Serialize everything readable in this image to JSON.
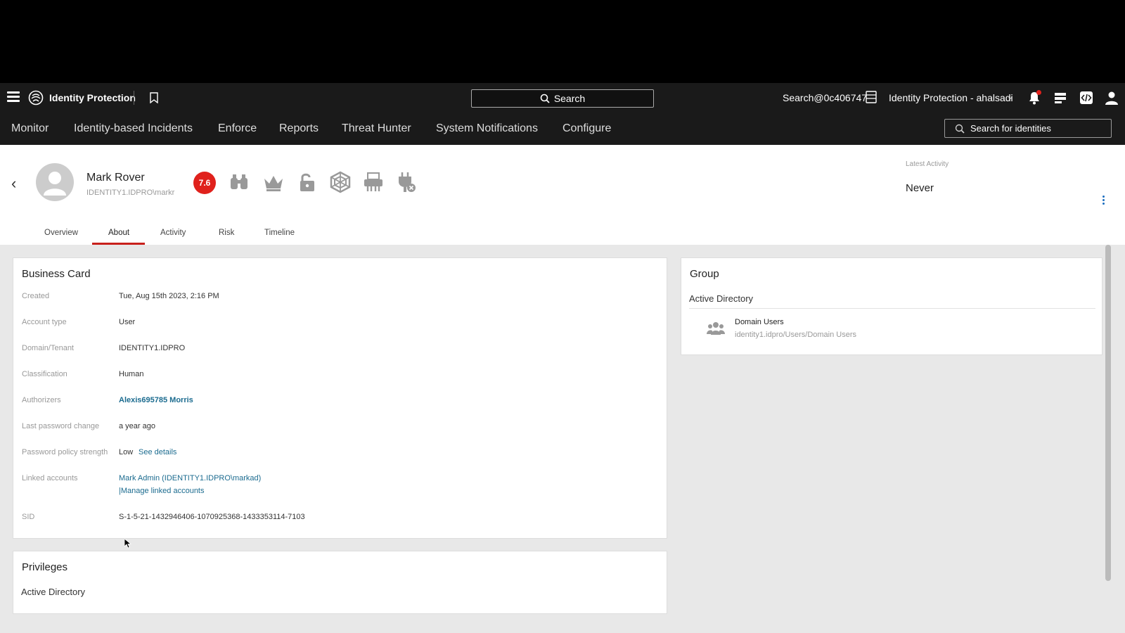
{
  "header": {
    "product_name": "Identity Protection",
    "search_label": "Search",
    "tenant_label": "Search@0c406747",
    "context_label": "Identity Protection - ahalsadi",
    "nav_items": [
      "Monitor",
      "Identity-based Incidents",
      "Enforce",
      "Reports",
      "Threat Hunter",
      "System Notifications",
      "Configure"
    ],
    "identity_search_placeholder": "Search for identities"
  },
  "profile": {
    "name": "Mark Rover",
    "account": "IDENTITY1.IDPRO\\markr",
    "risk_score": "7.6",
    "attribute_icons": [
      "binoculars-icon",
      "crown-icon",
      "unlocked-padlock-icon",
      "web-icon",
      "printer-icon",
      "plug-x-icon"
    ],
    "latest_activity_label": "Latest Activity",
    "latest_activity_value": "Never",
    "tabs": [
      "Overview",
      "About",
      "Activity",
      "Risk",
      "Timeline"
    ],
    "active_tab": "About"
  },
  "business_card": {
    "title": "Business Card",
    "created_label": "Created",
    "created_value": "Tue, Aug 15th 2023, 2:16 PM",
    "account_type_label": "Account type",
    "account_type_value": "User",
    "domain_label": "Domain/Tenant",
    "domain_value": "IDENTITY1.IDPRO",
    "classification_label": "Classification",
    "classification_value": "Human",
    "authorizers_label": "Authorizers",
    "authorizers_value": "Alexis695785 Morris",
    "last_pw_label": "Last password change",
    "last_pw_value": "a year ago",
    "pw_policy_label": "Password policy strength",
    "pw_policy_value": "Low",
    "pw_policy_link": "See details",
    "linked_label": "Linked accounts",
    "linked_value": "Mark Admin (IDENTITY1.IDPRO\\markad)",
    "linked_manage": "|Manage linked accounts",
    "sid_label": "SID",
    "sid_value": "S-1-5-21-1432946406-1070925368-1433353114-7103"
  },
  "group": {
    "title": "Group",
    "section": "Active Directory",
    "item_name": "Domain Users",
    "item_path": "identity1.idpro/Users/Domain Users"
  },
  "privileges": {
    "title": "Privileges",
    "section": "Active Directory"
  },
  "colors": {
    "risk": "#e0211c",
    "tab_active": "#c8201c",
    "link": "#1b6b8f",
    "header_bg": "#1a1a1a"
  }
}
